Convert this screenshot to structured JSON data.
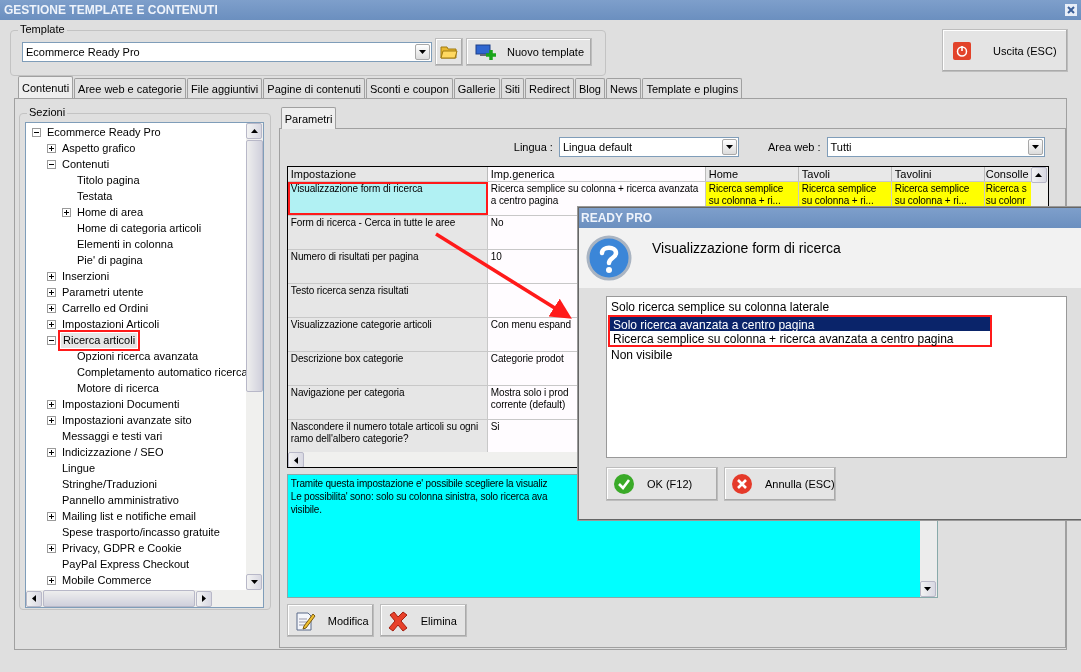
{
  "window": {
    "title": "GESTIONE TEMPLATE E CONTENUTI"
  },
  "template": {
    "label": "Template",
    "value": "Ecommerce Ready Pro",
    "new_button": "Nuovo template"
  },
  "exit_button": "Uscita (ESC)",
  "tabs": [
    {
      "label": "Contenuti",
      "selected": true
    },
    {
      "label": "Aree web e categorie",
      "selected": false
    },
    {
      "label": "File aggiuntivi",
      "selected": false
    },
    {
      "label": "Pagine di contenuti",
      "selected": false
    },
    {
      "label": "Sconti e coupon",
      "selected": false
    },
    {
      "label": "Gallerie",
      "selected": false
    },
    {
      "label": "Siti",
      "selected": false
    },
    {
      "label": "Redirect",
      "selected": false
    },
    {
      "label": "Blog",
      "selected": false
    },
    {
      "label": "News",
      "selected": false
    },
    {
      "label": "Template e plugins",
      "selected": false
    }
  ],
  "sections": {
    "label": "Sezioni",
    "tree": [
      {
        "label": "Ecommerce Ready Pro",
        "expanded": true,
        "selected": false,
        "children": [
          {
            "label": "Aspetto grafico",
            "expanded": false,
            "selected": false
          },
          {
            "label": "Contenuti",
            "expanded": true,
            "selected": false,
            "children": [
              {
                "label": "Titolo pagina",
                "selected": false
              },
              {
                "label": "Testata",
                "selected": false
              },
              {
                "label": "Home di area",
                "expanded": false,
                "selected": false
              },
              {
                "label": "Home di categoria articoli",
                "selected": false
              },
              {
                "label": "Elementi in colonna",
                "selected": false
              },
              {
                "label": "Pie' di pagina",
                "selected": false
              }
            ]
          },
          {
            "label": "Inserzioni",
            "expanded": false,
            "selected": false
          },
          {
            "label": "Parametri utente",
            "expanded": false,
            "selected": false
          },
          {
            "label": "Carrello ed Ordini",
            "expanded": false,
            "selected": false
          },
          {
            "label": "Impostazioni Articoli",
            "expanded": false,
            "selected": false
          },
          {
            "label": "Ricerca articoli",
            "expanded": true,
            "selected": true,
            "highlighted": true,
            "children": [
              {
                "label": "Opzioni ricerca avanzata",
                "selected": false
              },
              {
                "label": "Completamento automatico ricerca",
                "selected": false
              },
              {
                "label": "Motore di ricerca",
                "selected": false
              }
            ]
          },
          {
            "label": "Impostazioni Documenti",
            "expanded": false,
            "selected": false
          },
          {
            "label": "Impostazioni avanzate sito",
            "expanded": false,
            "selected": false
          },
          {
            "label": "Messaggi e testi vari",
            "selected": false
          },
          {
            "label": "Indicizzazione / SEO",
            "expanded": false,
            "selected": false
          },
          {
            "label": "Lingue",
            "selected": false
          },
          {
            "label": "Stringhe/Traduzioni",
            "selected": false
          },
          {
            "label": "Pannello amministrativo",
            "selected": false
          },
          {
            "label": "Mailing list e notifiche email",
            "expanded": false,
            "selected": false
          },
          {
            "label": "Spese trasporto/incasso gratuite",
            "selected": false
          },
          {
            "label": "Privacy, GDPR e Cookie",
            "expanded": false,
            "selected": false
          },
          {
            "label": "PayPal Express Checkout",
            "selected": false
          },
          {
            "label": "Mobile Commerce",
            "expanded": false,
            "selected": false
          }
        ]
      }
    ]
  },
  "params_tab": {
    "label": "Parametri",
    "selected": true
  },
  "language": {
    "label": "Lingua :",
    "value": "Lingua default"
  },
  "web_area": {
    "label": "Area web :",
    "value": "Tutti"
  },
  "table": {
    "columns": [
      "Impostazione",
      "Imp.generica",
      "Home",
      "Tavoli",
      "Tavolini",
      "Consolle"
    ],
    "rows": [
      {
        "selected": true,
        "highlighted": true,
        "cells": [
          "Visualizzazione form di ricerca",
          "Ricerca semplice su colonna + ricerca avanzata a centro pagina"
        ],
        "area_cells": [
          "Ricerca semplice\nsu colonna + ri...",
          "Ricerca semplice\nsu colonna + ri...",
          "Ricerca semplice\nsu colonna + ri...",
          "Ricerca s\nsu colonr"
        ]
      },
      {
        "selected": false,
        "highlighted": false,
        "cells": [
          "Form di ricerca - Cerca in tutte le aree",
          "No"
        ]
      },
      {
        "selected": false,
        "highlighted": false,
        "cells": [
          "Numero di risultati per pagina",
          "10"
        ]
      },
      {
        "selected": false,
        "highlighted": false,
        "cells": [
          "Testo ricerca senza risultati",
          ""
        ]
      },
      {
        "selected": false,
        "highlighted": false,
        "cells": [
          "Visualizzazione categorie articoli",
          "Con menu espand"
        ]
      },
      {
        "selected": false,
        "highlighted": false,
        "cells": [
          "Descrizione box categorie",
          "Categorie prodot"
        ]
      },
      {
        "selected": false,
        "highlighted": false,
        "cells": [
          "Navigazione per categoria",
          "Mostra solo i prod\ncorrente (default)"
        ]
      },
      {
        "selected": false,
        "highlighted": false,
        "cells": [
          "Nascondere il numero totale articoli su ogni ramo dell'albero categorie?",
          "Si"
        ]
      }
    ]
  },
  "description": [
    "Tramite questa impostazione e' possibile scegliere la visualiz",
    "Le possibilita' sono: solo su colonna sinistra, solo ricerca ava",
    "visibile."
  ],
  "buttons": [
    "Modifica",
    "Elimina"
  ],
  "dialog": {
    "title": "READY PRO",
    "heading": "Visualizzazione form di ricerca",
    "options": [
      {
        "label": "Solo ricerca semplice su colonna laterale",
        "selected": false,
        "highlighted": false
      },
      {
        "label": "Solo ricerca avanzata a centro pagina",
        "selected": true,
        "highlighted": true
      },
      {
        "label": "Ricerca semplice su colonna + ricerca avanzata a centro pagina",
        "selected": false,
        "highlighted": true
      },
      {
        "label": "Non visibile",
        "selected": false,
        "highlighted": false
      }
    ],
    "ok_button": "OK (F12)",
    "cancel_button": "Annulla (ESC)"
  }
}
